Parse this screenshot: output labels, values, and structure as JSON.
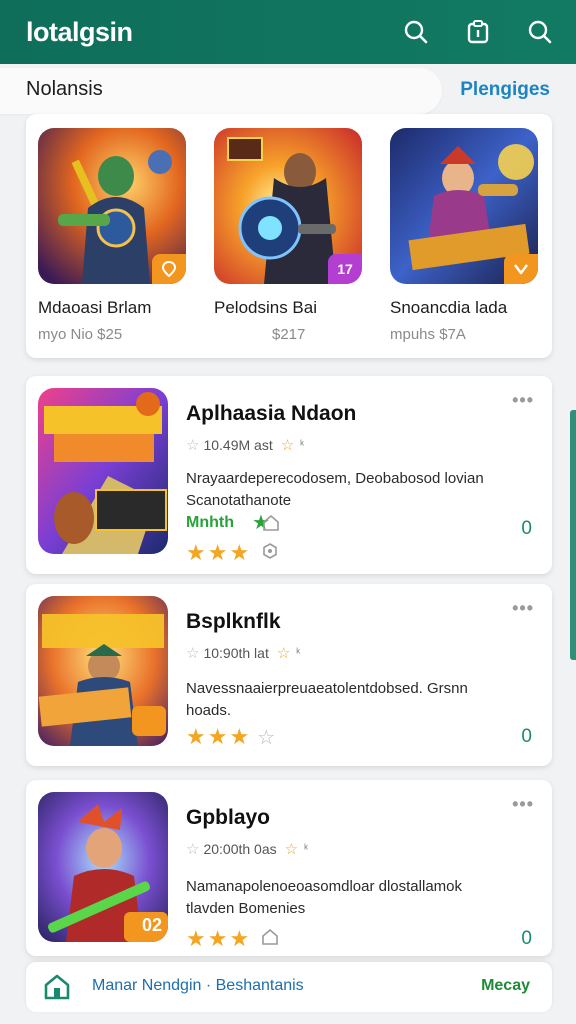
{
  "app": {
    "title": "lotalgsin"
  },
  "header": {
    "icons": [
      "search-icon",
      "clipboard-icon",
      "search-icon"
    ]
  },
  "section": {
    "title": "Nolansis",
    "link": "Plengiges"
  },
  "featured": [
    {
      "name": "Mdaoasi Brlam",
      "sub": "myo Nio $25",
      "badge": "",
      "badge_color": "#f2961f"
    },
    {
      "name": "Pelodsins Bai",
      "sub": "$217",
      "badge": "17",
      "badge_color": "#b33ed1"
    },
    {
      "name": "Snoancdia lada",
      "sub": "mpuhs $7A",
      "badge": "",
      "badge_color": "#f2961f"
    }
  ],
  "apps": [
    {
      "title": "Aplhaasia Ndaon",
      "meta": "10.49M ast",
      "desc_line1": "Nrayaardeperecodosem, Deobabosod lovian",
      "desc_line2": "Scanotathanote",
      "tag": "Mnhth",
      "rating": 3,
      "count": "0"
    },
    {
      "title": "Bsplknflk",
      "meta": "10:90th lat",
      "desc_line1": "Navessnaaierpreuaeatolentdobsed. Grsnn",
      "desc_line2": "hoads.",
      "tag": "",
      "rating": 3,
      "count": "0"
    },
    {
      "title": "Gpblayo",
      "meta": "20:00th 0as",
      "desc_line1": "Namanapolenoeoasomdloar dlostallamok",
      "desc_line2": "tlavden Bomenies",
      "tag": "",
      "rating": 3,
      "count": "0",
      "badge": "02"
    }
  ],
  "bottom": {
    "label": "Manar Nendgin · Beshantanis",
    "right": "Mecay"
  },
  "colors": {
    "header": "#0e6e5a",
    "accent": "#1b84c4",
    "star": "#f2a623",
    "count": "#1a8a6e"
  }
}
